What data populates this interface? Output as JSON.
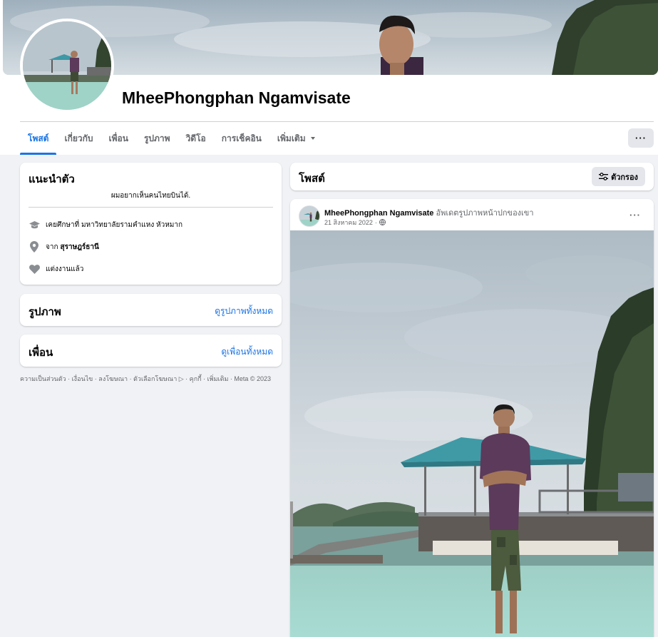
{
  "profile": {
    "name": "MheePhongphan Ngamvisate"
  },
  "tabs": [
    {
      "label": "โพสต์",
      "active": true
    },
    {
      "label": "เกี่ยวกับ"
    },
    {
      "label": "เพื่อน"
    },
    {
      "label": "รูปภาพ"
    },
    {
      "label": "วิดีโอ"
    },
    {
      "label": "การเช็คอิน"
    },
    {
      "label": "เพิ่มเติม"
    }
  ],
  "more_button": "···",
  "intro": {
    "title": "แนะนำตัว",
    "bio": "ผมอยากเห็นคนไทยบินได้.",
    "education": "เคยศึกษาที่ มหาวิทยาลัยรามคำแหง หัวหมาก",
    "location_prefix": "จาก",
    "location": "สุราษฎร์ธานี",
    "relationship": "แต่งงานแล้ว",
    "icons": [
      "graduation-cap-icon",
      "location-pin-icon",
      "heart-icon"
    ]
  },
  "photos": {
    "title": "รูปภาพ",
    "link": "ดูรูปภาพทั้งหมด"
  },
  "friends": {
    "title": "เพื่อน",
    "link": "ดูเพื่อนทั้งหมด"
  },
  "footer": {
    "text": "ความเป็นส่วนตัว · เงื่อนไข · ลงโฆษณา · ตัวเลือกโฆษณา ▷ · คุกกี้ · เพิ่มเติม · Meta © 2023"
  },
  "posts": {
    "title": "โพสต์",
    "filter_label": "ตัวกรอง"
  },
  "post": {
    "author": "MheePhongphan Ngamvisate",
    "action": "อัพเดตรูปภาพหน้าปกของเขา",
    "date": "21 สิงหาคม 2022",
    "separator": "·",
    "more": "···"
  },
  "colors": {
    "accent": "#1b74e4",
    "background": "#f0f2f5",
    "card": "#ffffff",
    "secondary_text": "#65676b",
    "button_bg": "#e4e6eb"
  }
}
